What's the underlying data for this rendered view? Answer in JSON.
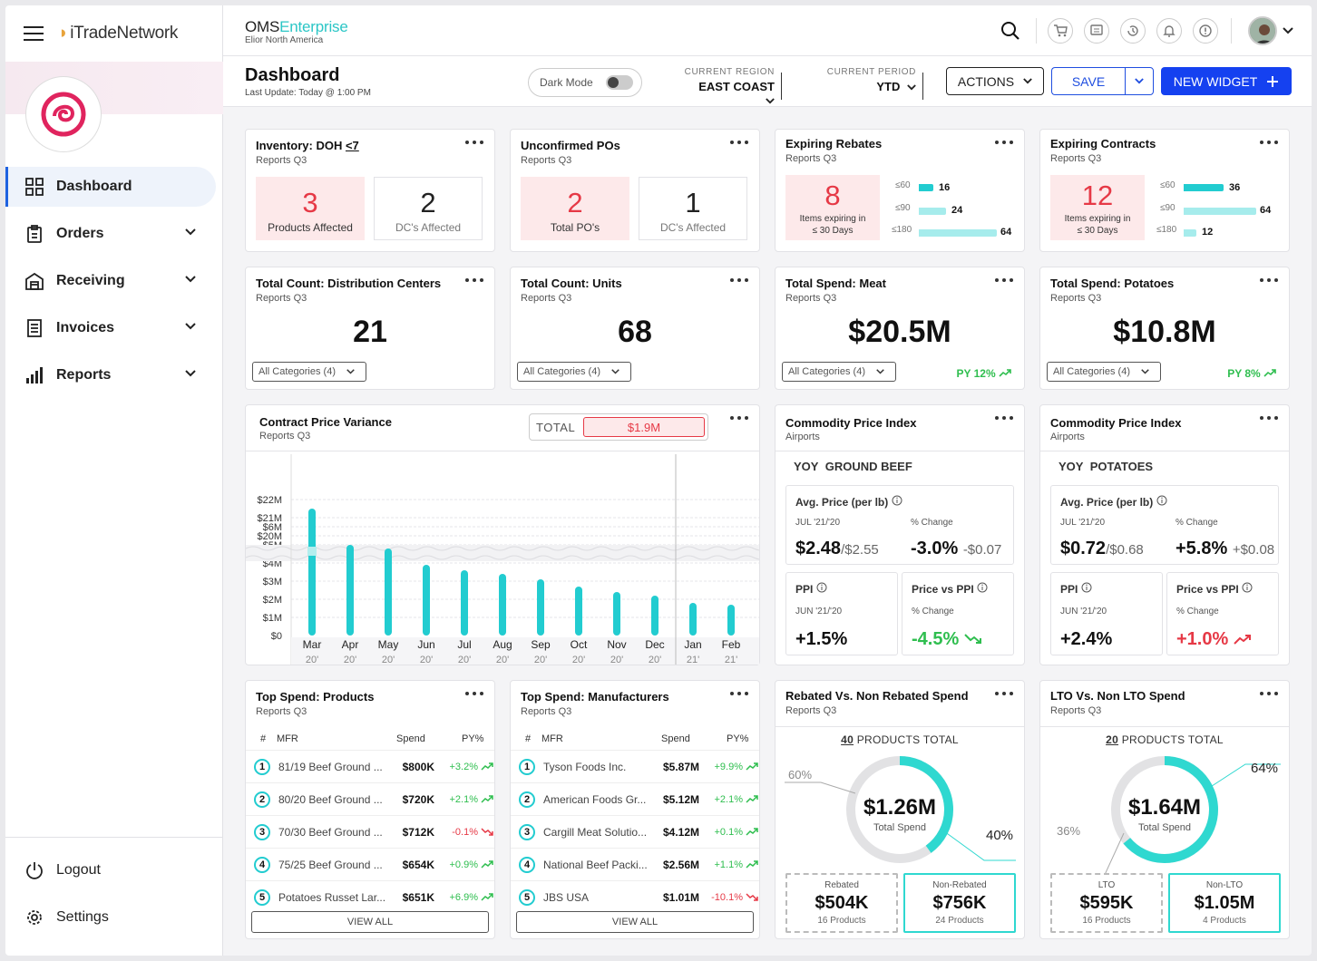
{
  "sidebar": {
    "brand": "iTradeNetwork",
    "items": [
      {
        "label": "Dashboard"
      },
      {
        "label": "Orders"
      },
      {
        "label": "Receiving"
      },
      {
        "label": "Invoices"
      },
      {
        "label": "Reports"
      }
    ],
    "bottom": [
      {
        "label": "Logout"
      },
      {
        "label": "Settings"
      }
    ]
  },
  "header": {
    "app_name": "OMS",
    "app_name_accent": "Enterprise",
    "company": "Elior North America"
  },
  "subheader": {
    "title": "Dashboard",
    "last_update": "Last Update: Today @ 1:00 PM",
    "dark_mode_label": "Dark Mode",
    "region_label": "CURRENT REGION",
    "region_value": "EAST COAST",
    "period_label": "CURRENT PERIOD",
    "period_value": "YTD",
    "actions_label": "ACTIONS",
    "save_label": "SAVE",
    "new_widget_label": "NEW WIDGET"
  },
  "cards": {
    "inventory": {
      "title": "Inventory:  DOH",
      "link": "<7",
      "subtitle": "Reports Q3",
      "stat1_value": "3",
      "stat1_label": "Products Affected",
      "stat2_value": "2",
      "stat2_label": "DC's Affected"
    },
    "unconfirmed": {
      "title": "Unconfirmed POs",
      "subtitle": "Reports Q3",
      "stat1_value": "2",
      "stat1_label": "Total PO's",
      "stat2_value": "1",
      "stat2_label": "DC's Affected"
    },
    "rebates": {
      "title": "Expiring Rebates",
      "subtitle": "Reports Q3",
      "big": "8",
      "line1": "Items expiring in",
      "line2": "≤ 30 Days",
      "rows": [
        {
          "k": "≤60",
          "v": "16"
        },
        {
          "k": "≤90",
          "v": "24"
        },
        {
          "k": "≤180",
          "v": "64"
        }
      ]
    },
    "contracts": {
      "title": "Expiring Contracts",
      "subtitle": "Reports Q3",
      "big": "12",
      "line1": "Items expiring in",
      "line2": "≤ 30 Days",
      "rows": [
        {
          "k": "≤60",
          "v": "36"
        },
        {
          "k": "≤90",
          "v": "64"
        },
        {
          "k": "≤180",
          "v": "12"
        }
      ]
    },
    "dc": {
      "title": "Total Count: Distribution Centers",
      "subtitle": "Reports Q3",
      "value": "21",
      "select": "All Categories (4)"
    },
    "units": {
      "title": "Total Count: Units",
      "subtitle": "Reports Q3",
      "value": "68",
      "select": "All Categories (4)"
    },
    "meat": {
      "title": "Total Spend: Meat",
      "subtitle": "Reports Q3",
      "value": "$20.5M",
      "select": "All Categories (4)",
      "py": "PY 12%"
    },
    "potatoes": {
      "title": "Total Spend: Potatoes",
      "subtitle": "Reports Q3",
      "value": "$10.8M",
      "select": "All Categories (4)",
      "py": "PY 8%"
    },
    "cpv": {
      "title": "Contract Price Variance",
      "subtitle": "Reports Q3",
      "total_label": "TOTAL",
      "total_value": "$1.9M"
    },
    "cpi_beef": {
      "title": "Commodity Price Index",
      "subtitle": "Airports",
      "yoy": "YOY",
      "item": "GROUND BEEF",
      "avg_label": "Avg. Price (per lb)",
      "avg_period": "JUL '21/'20",
      "avg_change_label": "% Change",
      "avg_value": "$2.48",
      "avg_prev": "/$2.55",
      "avg_change": "-3.0%",
      "avg_delta": "-$0.07",
      "ppi_label": "PPI",
      "ppi_period": "JUN '21/'20",
      "ppi_value": "+1.5%",
      "pvp_label": "Price vs PPI",
      "pvp_change_label": "% Change",
      "pvp_value": "-4.5%"
    },
    "cpi_potato": {
      "title": "Commodity Price Index",
      "subtitle": "Airports",
      "yoy": "YOY",
      "item": "POTATOES",
      "avg_label": "Avg. Price (per lb)",
      "avg_period": "JUL '21/'20",
      "avg_change_label": "% Change",
      "avg_value": "$0.72",
      "avg_prev": "/$0.68",
      "avg_change": "+5.8%",
      "avg_delta": "+$0.08",
      "ppi_label": "PPI",
      "ppi_period": "JUN '21/'20",
      "ppi_value": "+2.4%",
      "pvp_label": "Price vs PPI",
      "pvp_change_label": "% Change",
      "pvp_value": "+1.0%"
    },
    "top_products": {
      "title": "Top Spend: Products",
      "subtitle": "Reports Q3",
      "cols": [
        "#",
        "MFR",
        "Spend",
        "PY%"
      ],
      "view_all": "VIEW ALL",
      "rows": [
        {
          "n": "1",
          "name": "81/19 Beef Ground ...",
          "spend": "$800K",
          "py": "+3.2%",
          "up": true
        },
        {
          "n": "2",
          "name": "80/20 Beef Ground ...",
          "spend": "$720K",
          "py": "+2.1%",
          "up": true
        },
        {
          "n": "3",
          "name": "70/30 Beef Ground ...",
          "spend": "$712K",
          "py": "-0.1%",
          "up": false
        },
        {
          "n": "4",
          "name": "75/25 Beef Ground ...",
          "spend": "$654K",
          "py": "+0.9%",
          "up": true
        },
        {
          "n": "5",
          "name": "Potatoes Russet Lar...",
          "spend": "$651K",
          "py": "+6.9%",
          "up": true
        }
      ]
    },
    "top_mfr": {
      "title": "Top Spend: Manufacturers",
      "subtitle": "Reports Q3",
      "cols": [
        "#",
        "MFR",
        "Spend",
        "PY%"
      ],
      "view_all": "VIEW ALL",
      "rows": [
        {
          "n": "1",
          "name": "Tyson Foods Inc.",
          "spend": "$5.87M",
          "py": "+9.9%",
          "up": true
        },
        {
          "n": "2",
          "name": "American Foods Gr...",
          "spend": "$5.12M",
          "py": "+2.1%",
          "up": true
        },
        {
          "n": "3",
          "name": "Cargill Meat Solutio...",
          "spend": "$4.12M",
          "py": "+0.1%",
          "up": true
        },
        {
          "n": "4",
          "name": "National Beef Packi...",
          "spend": "$2.56M",
          "py": "+1.1%",
          "up": true
        },
        {
          "n": "5",
          "name": "JBS USA",
          "spend": "$1.01M",
          "py": "-10.1%",
          "up": false
        }
      ]
    },
    "rebated": {
      "title": "Rebated Vs. Non Rebated Spend",
      "subtitle": "Reports Q3",
      "count": "40",
      "count_label": "PRODUCTS TOTAL",
      "center_value": "$1.26M",
      "center_label": "Total Spend",
      "pct_left": "60%",
      "pct_right": "40%",
      "box1_h": "Rebated",
      "box1_v": "$504K",
      "box1_s": "16 Products",
      "box2_h": "Non-Rebated",
      "box2_v": "$756K",
      "box2_s": "24 Products"
    },
    "lto": {
      "title": "LTO Vs. Non LTO Spend",
      "subtitle": "Reports Q3",
      "count": "20",
      "count_label": "PRODUCTS TOTAL",
      "center_value": "$1.64M",
      "center_label": "Total Spend",
      "pct_left": "36%",
      "pct_right": "64%",
      "box1_h": "LTO",
      "box1_v": "$595K",
      "box1_s": "16 Products",
      "box2_h": "Non-LTO",
      "box2_v": "$1.05M",
      "box2_s": "4 Products"
    }
  },
  "chart_data": {
    "type": "bar",
    "title": "Contract Price Variance",
    "categories": [
      "Mar",
      "Apr",
      "May",
      "Jun",
      "Jul",
      "Aug",
      "Sep",
      "Oct",
      "Nov",
      "Dec",
      "Jan",
      "Feb"
    ],
    "years": [
      "20'",
      "20'",
      "20'",
      "20'",
      "20'",
      "20'",
      "20'",
      "20'",
      "20'",
      "20'",
      "21'",
      "21'"
    ],
    "values": [
      21.5,
      5.0,
      4.8,
      3.9,
      3.6,
      3.4,
      3.1,
      2.7,
      2.4,
      2.2,
      1.8,
      1.7
    ],
    "y_ticks": [
      "$0",
      "$1M",
      "$2M",
      "$3M",
      "$4M",
      "$5M",
      "$6M",
      "$20M",
      "$21M",
      "$22M"
    ],
    "axis_break": true,
    "bar_color": "#22ccd0"
  }
}
